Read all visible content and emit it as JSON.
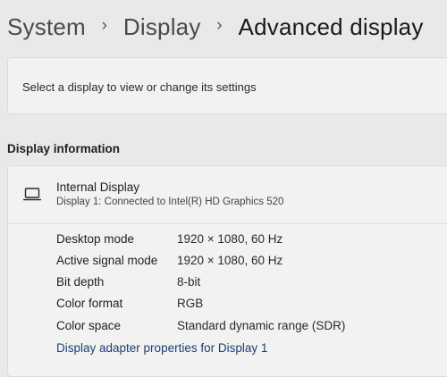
{
  "breadcrumb": {
    "items": [
      "System",
      "Display",
      "Advanced display"
    ],
    "separator": "›"
  },
  "select_card": {
    "text": "Select a display to view or change its settings"
  },
  "section": {
    "heading": "Display information"
  },
  "display": {
    "icon": "laptop-monitor-icon",
    "name": "Internal Display",
    "subtitle": "Display 1: Connected to Intel(R) HD Graphics 520"
  },
  "info": {
    "rows": [
      {
        "label": "Desktop mode",
        "value": "1920 × 1080, 60 Hz"
      },
      {
        "label": "Active signal mode",
        "value": "1920 × 1080, 60 Hz"
      },
      {
        "label": "Bit depth",
        "value": "8-bit"
      },
      {
        "label": "Color format",
        "value": "RGB"
      },
      {
        "label": "Color space",
        "value": "Standard dynamic range (SDR)"
      }
    ],
    "adapter_link": "Display adapter properties for Display 1"
  },
  "colors": {
    "background": "#e9e9e7",
    "card": "#f2f2f1",
    "link": "#1c3f73"
  }
}
